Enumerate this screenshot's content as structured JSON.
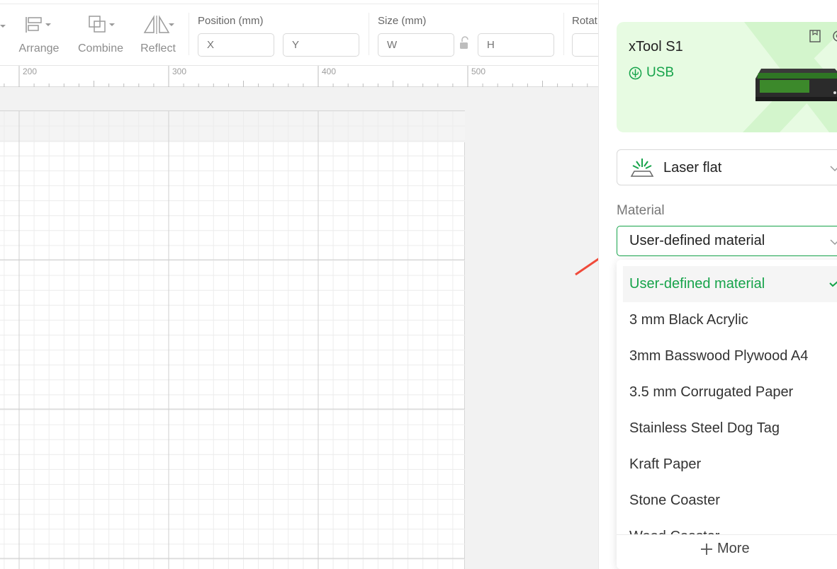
{
  "toolbar": {
    "tools": [
      {
        "label": "Arrange",
        "icon": "arrange-icon"
      },
      {
        "label": "Combine",
        "icon": "combine-icon"
      },
      {
        "label": "Reflect",
        "icon": "reflect-icon"
      }
    ],
    "position": {
      "title": "Position (mm)",
      "x_placeholder": "X",
      "y_placeholder": "Y"
    },
    "size": {
      "title": "Size (mm)",
      "w_placeholder": "W",
      "h_placeholder": "H"
    },
    "rotate": {
      "title": "Rotat"
    }
  },
  "ruler": {
    "labels": [
      "200",
      "300",
      "400",
      "500"
    ]
  },
  "device": {
    "name": "xTool S1",
    "connection": "USB",
    "accent_color": "#16a34a",
    "card_bg": "#e7fbe2"
  },
  "mode": {
    "selected": "Laser flat",
    "icon": "laser-flat-icon"
  },
  "material": {
    "label": "Material",
    "selected": "User-defined material",
    "options": [
      "User-defined material",
      "3 mm Black Acrylic",
      "3mm Basswood Plywood A4",
      "3.5 mm Corrugated Paper",
      "Stainless Steel Dog Tag",
      "Kraft Paper",
      "Stone Coaster",
      "Wood Coaster"
    ],
    "more_label": "More"
  }
}
